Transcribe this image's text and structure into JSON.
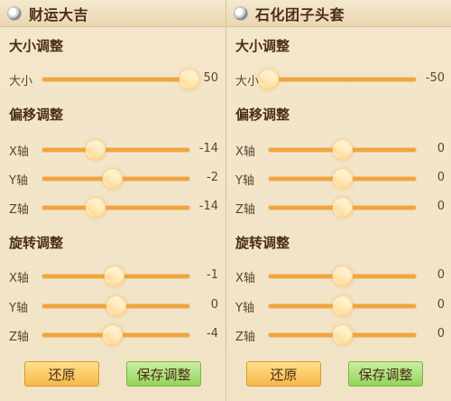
{
  "panels": [
    {
      "title": "财运大吉",
      "size_section": "大小调整",
      "size_label": "大小",
      "size_value": "50",
      "size_fraction": 1.0,
      "offset_section": "偏移调整",
      "offset": [
        {
          "label": "X轴",
          "value": "-14",
          "fraction": 0.36
        },
        {
          "label": "Y轴",
          "value": "-2",
          "fraction": 0.48
        },
        {
          "label": "Z轴",
          "value": "-14",
          "fraction": 0.36
        }
      ],
      "rotate_section": "旋转调整",
      "rotate": [
        {
          "label": "X轴",
          "value": "-1",
          "fraction": 0.49
        },
        {
          "label": "Y轴",
          "value": "0",
          "fraction": 0.5
        },
        {
          "label": "Z轴",
          "value": "-4",
          "fraction": 0.48
        }
      ],
      "reset_label": "还原",
      "save_label": "保存调整"
    },
    {
      "title": "石化团子头套",
      "size_section": "大小调整",
      "size_label": "大小",
      "size_value": "-50",
      "size_fraction": 0.0,
      "offset_section": "偏移调整",
      "offset": [
        {
          "label": "X轴",
          "value": "0",
          "fraction": 0.5
        },
        {
          "label": "Y轴",
          "value": "0",
          "fraction": 0.5
        },
        {
          "label": "Z轴",
          "value": "0",
          "fraction": 0.5
        }
      ],
      "rotate_section": "旋转调整",
      "rotate": [
        {
          "label": "X轴",
          "value": "0",
          "fraction": 0.5
        },
        {
          "label": "Y轴",
          "value": "0",
          "fraction": 0.5
        },
        {
          "label": "Z轴",
          "value": "0",
          "fraction": 0.5
        }
      ],
      "reset_label": "还原",
      "save_label": "保存调整"
    }
  ],
  "colors": {
    "track": "#f3a53a",
    "reset_button": "#f5b94a",
    "save_button": "#95d35b"
  }
}
